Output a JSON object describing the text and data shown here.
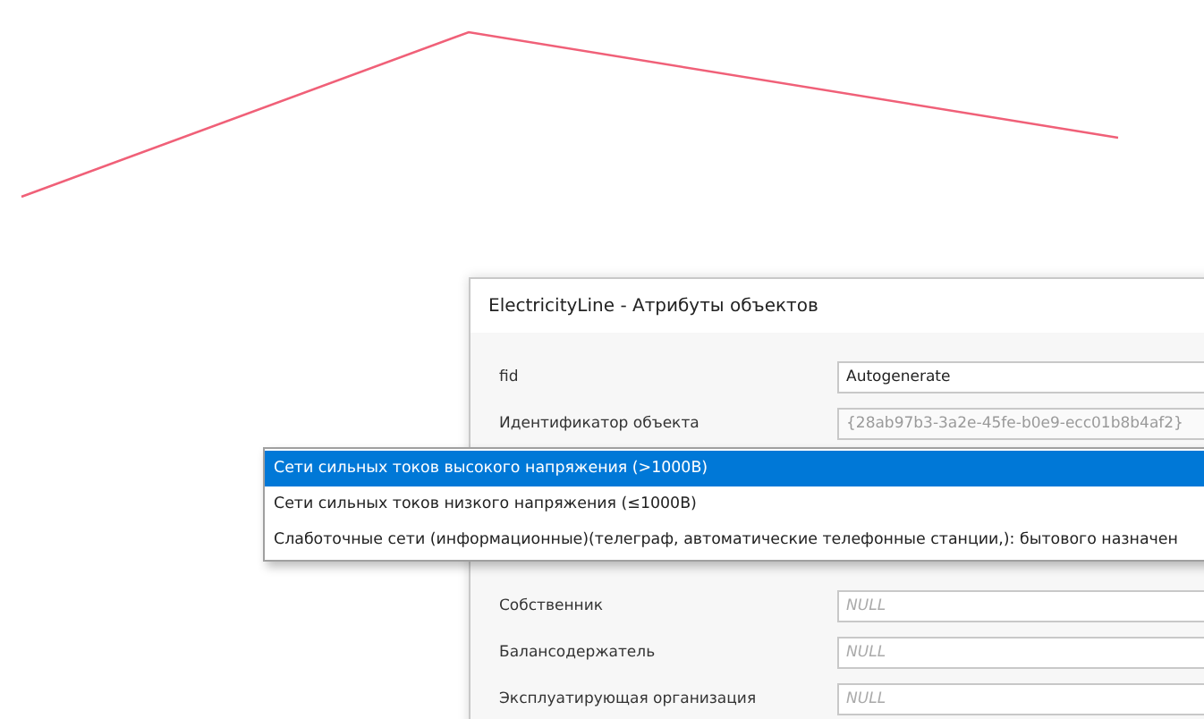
{
  "dialog": {
    "title": "ElectricityLine - Атрибуты объектов",
    "fields_above": [
      {
        "label": "fid",
        "value": "Autogenerate",
        "disabled": false
      },
      {
        "label": "Идентификатор объекта",
        "value": "{28ab97b3-3a2e-45fe-b0e9-ecc01b8b4af2}",
        "disabled": true
      }
    ],
    "fields_below": [
      {
        "label": "Собственник",
        "placeholder": "NULL"
      },
      {
        "label": "Балансодержатель",
        "placeholder": "NULL"
      },
      {
        "label": "Эксплуатирующая организация",
        "placeholder": "NULL"
      }
    ]
  },
  "dropdown": {
    "options": [
      {
        "label": "Сети сильных токов высокого напряжения (>1000В)",
        "selected": true
      },
      {
        "label": "Сети сильных токов низкого напряжения (≤1000В)",
        "selected": false
      },
      {
        "label": "Слаботочные сети (информационные)(телеграф, автоматические телефонные станции,): бытового назначен",
        "selected": false
      }
    ]
  }
}
